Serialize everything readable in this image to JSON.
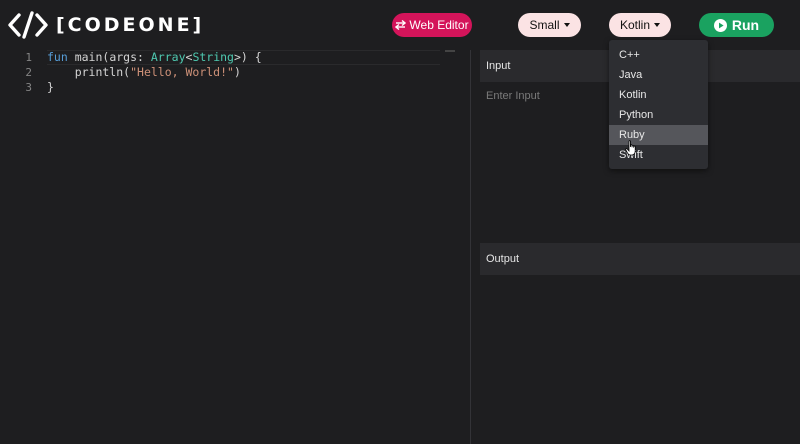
{
  "brand": {
    "name": "[CODEONE]"
  },
  "toolbar": {
    "web_editor_label": "Web Editor",
    "size_label": "Small",
    "language_label": "Kotlin",
    "run_label": "Run"
  },
  "editor": {
    "line_numbers": [
      "1",
      "2",
      "3"
    ],
    "lines": [
      "fun main(args: Array<String>) {",
      "    println(\"Hello, World!\")",
      "}"
    ]
  },
  "input_panel": {
    "title": "Input",
    "placeholder": "Enter Input"
  },
  "output_panel": {
    "title": "Output"
  },
  "language_dropdown": {
    "options": [
      "C++",
      "Java",
      "Kotlin",
      "Python",
      "Ruby",
      "Swift"
    ],
    "hovered": "Ruby"
  },
  "colors": {
    "background": "#1e1e20",
    "web_editor_button": "#d4145a",
    "run_button": "#1aa260",
    "pill_button": "#fbe3e4",
    "panel_header": "#2a2a2d",
    "keyword": "#569cd6",
    "type": "#4ec9b0",
    "string": "#ce9178"
  }
}
